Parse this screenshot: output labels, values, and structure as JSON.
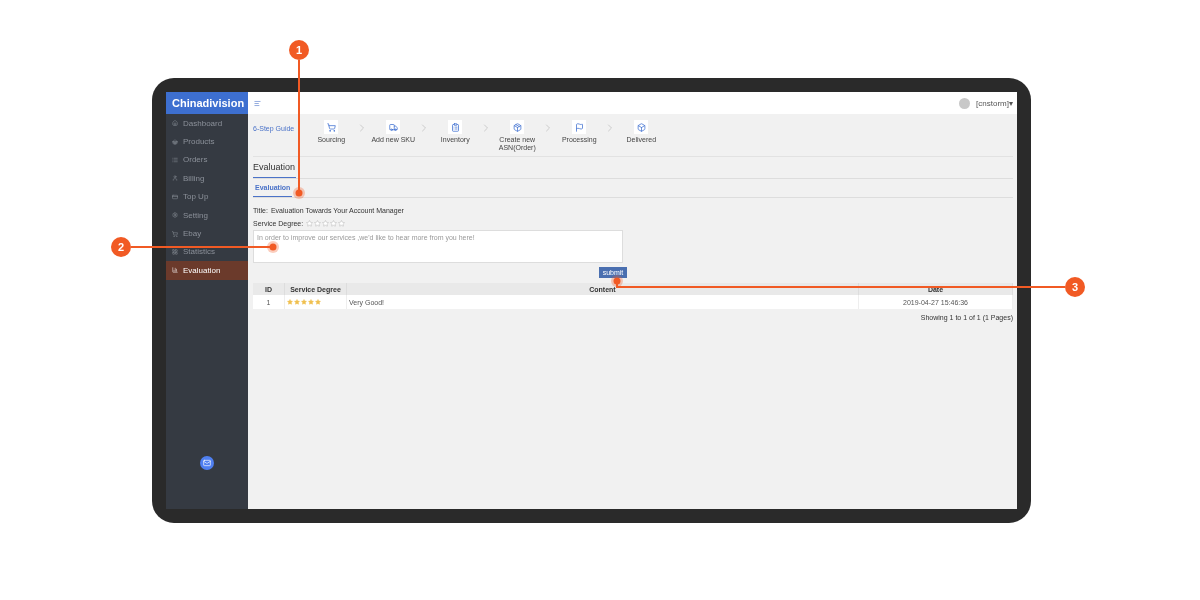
{
  "sidebar": {
    "logo": "Chinadivision",
    "items": [
      {
        "label": "Dashboard",
        "kind": "home",
        "selected": false
      },
      {
        "label": "Products",
        "kind": "basket",
        "selected": false
      },
      {
        "label": "Orders",
        "kind": "list",
        "selected": false
      },
      {
        "label": "Billing",
        "kind": "user",
        "selected": false
      },
      {
        "label": "Top Up",
        "kind": "card",
        "selected": false
      },
      {
        "label": "Setting",
        "kind": "gear",
        "selected": false
      },
      {
        "label": "Ebay",
        "kind": "cart",
        "selected": false
      },
      {
        "label": "Statistics",
        "kind": "grid",
        "selected": false
      },
      {
        "label": "Evaluation",
        "kind": "chart",
        "selected": true
      }
    ]
  },
  "topbar": {
    "user": "[cnstorm]",
    "caret": "▾"
  },
  "guide": {
    "title": "6-Step Guide",
    "steps": [
      {
        "label": "Sourcing",
        "kind": "cart"
      },
      {
        "label": "Add new SKU",
        "kind": "truck"
      },
      {
        "label": "Inventory",
        "kind": "list"
      },
      {
        "label": "Create new ASN(Order)",
        "kind": "bag"
      },
      {
        "label": "Processing",
        "kind": "flag"
      },
      {
        "label": "Delivered",
        "kind": "box"
      }
    ]
  },
  "page_title": "Evaluation",
  "tabs": [
    {
      "label": "Evaluation",
      "selected": true
    }
  ],
  "form": {
    "title_label": "Title:",
    "title_value": "Evaluation Towards Your Account Manager",
    "rating_label": "Service Degree:",
    "stars": 0,
    "placeholder": "In order to improve our services ,we'd like to hear more from you here!",
    "submit": "submit"
  },
  "table": {
    "columns": [
      "ID",
      "Service Degree",
      "Content",
      "Date"
    ],
    "rows": [
      {
        "id": "1",
        "stars": 5,
        "content": "Very Good!",
        "date": "2019-04-27 15:46:36"
      }
    ]
  },
  "pagination": "Showing 1 to 1 of 1 (1 Pages)",
  "callouts": [
    {
      "label": "1"
    },
    {
      "label": "2"
    },
    {
      "label": "3"
    }
  ]
}
